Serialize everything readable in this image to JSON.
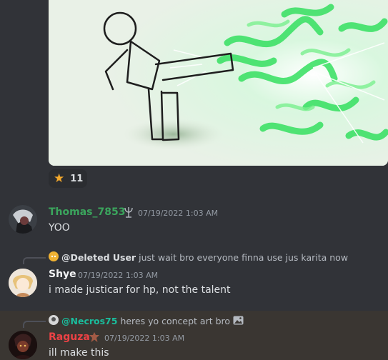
{
  "artwork": {
    "alt": "concept art"
  },
  "reaction": {
    "emoji": "★",
    "count": "11"
  },
  "messages": [
    {
      "username": "Thomas_7853",
      "username_color": "#3ba55d",
      "timestamp": "07/19/2022 1:03 AM",
      "text": "YOO"
    },
    {
      "reply": {
        "name": "@Deleted User",
        "name_color": "#dbdee1",
        "text": "just wait bro everyone finna use jus karita now"
      },
      "username": "Shye",
      "username_color": "#f2f3f5",
      "timestamp": "07/19/2022 1:03 AM",
      "text": "i made justicar for hp, not the talent"
    },
    {
      "reply": {
        "name": "@Necros75",
        "name_color": "#1abc9c",
        "text": "heres yo concept art bro"
      },
      "username": "Raguza",
      "username_color": "#ed4245",
      "timestamp": "07/19/2022 1:03 AM",
      "text": "ill make this"
    }
  ],
  "colors": {
    "background": "#313338",
    "highlight": "#3a3632",
    "art_green": "#35e060"
  }
}
